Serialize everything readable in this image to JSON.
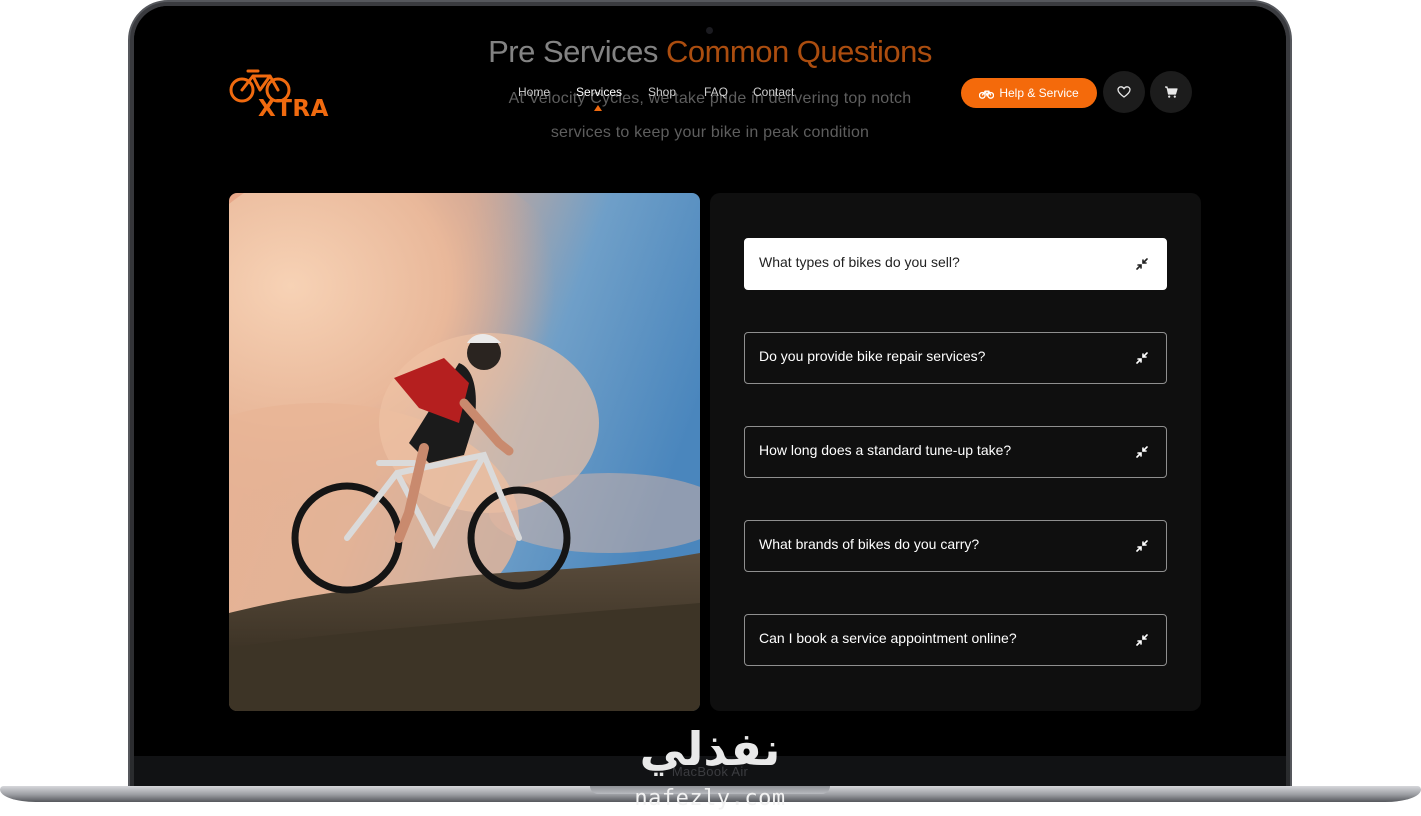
{
  "page": {
    "ghost_heading_plain": "Pre Services ",
    "ghost_heading_accent": "Common Questions",
    "ghost_sub_line1": "At Velocity Cycles, we take pride in delivering top notch",
    "ghost_sub_line2": "services to keep your bike in peak condition"
  },
  "brand": {
    "name": "XTRA",
    "accent_color": "#f46a0b"
  },
  "nav": {
    "items": [
      {
        "label": "Home"
      },
      {
        "label": "Services",
        "active": true
      },
      {
        "label": "Shop"
      },
      {
        "label": "FAQ"
      },
      {
        "label": "Contact"
      }
    ],
    "help_button": "Help & Service",
    "wishlist_icon": "heart-icon",
    "cart_icon": "cart-icon"
  },
  "faq": {
    "items": [
      {
        "question": "What types of bikes do you sell?",
        "open": true
      },
      {
        "question": "Do you provide bike repair services?",
        "open": false
      },
      {
        "question": "How long does a standard tune-up take?",
        "open": false
      },
      {
        "question": "What brands of bikes do you carry?",
        "open": false
      },
      {
        "question": "Can I book a service appointment online?",
        "open": false
      }
    ],
    "toggle_icon": "collapse-arrows-icon"
  },
  "device": {
    "label": "MacBook Air"
  },
  "watermark": {
    "arabic": "نفذلي",
    "latin": "nafezly.com"
  }
}
